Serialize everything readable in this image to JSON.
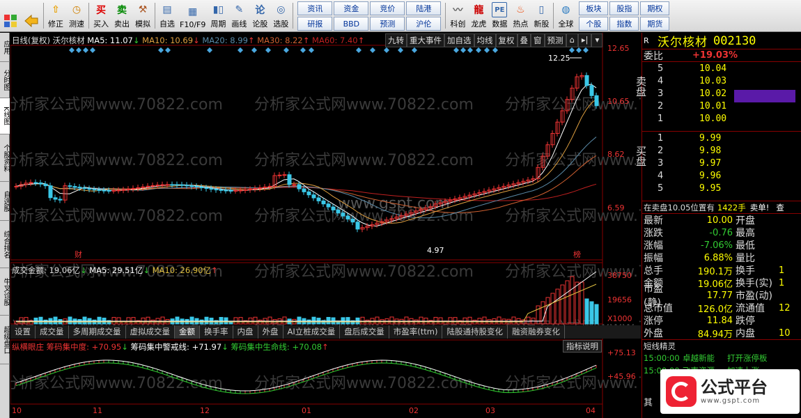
{
  "toolbar": {
    "buttons": [
      {
        "label": "修正",
        "icon": "up-arrow-icon"
      },
      {
        "label": "测速",
        "icon": "clock-icon"
      },
      {
        "label": "买入",
        "icon": "buy-icon"
      },
      {
        "label": "卖出",
        "icon": "sell-icon"
      },
      {
        "label": "模拟",
        "icon": "hammer-icon"
      },
      {
        "label": "自选",
        "icon": "folder-icon"
      },
      {
        "label": "F10/F9",
        "icon": "f10-icon"
      },
      {
        "label": "周期",
        "icon": "period-icon"
      },
      {
        "label": "画线",
        "icon": "pen-icon"
      },
      {
        "label": "论股",
        "icon": "discuss-icon"
      },
      {
        "label": "选股",
        "icon": "stock-pick-icon"
      }
    ],
    "grid": [
      "资讯",
      "资金",
      "竞价",
      "陆港",
      "研报",
      "BBD",
      "预测",
      "沪伦"
    ],
    "buttons2": [
      {
        "label": "科创",
        "icon": "sci-icon"
      },
      {
        "label": "龙虎",
        "icon": "dragon-icon"
      },
      {
        "label": "数据",
        "icon": "pe-icon"
      },
      {
        "label": "热点",
        "icon": "hot-icon"
      },
      {
        "label": "新股",
        "icon": "ipo-icon"
      },
      {
        "label": "全球",
        "icon": "globe-icon"
      }
    ],
    "grid2": [
      "板块",
      "股指",
      "期权",
      "个股",
      "指数",
      "期货"
    ]
  },
  "lefttabs": [
    "应用",
    "分时图",
    "K线图",
    "个股资料",
    "自选股",
    "综合排名",
    "牛叉诊股",
    "超级盘口"
  ],
  "chart_header": {
    "period": "日线(复权)",
    "name": "沃尔核材",
    "ma5": "MA5: 11.07",
    "ma10": "MA10: 10.69",
    "ma20": "MA20: 8.99",
    "ma30": "MA30: 8.22",
    "ma60": "MA60: 7.40"
  },
  "chart_tools": [
    "九转",
    "重大事件",
    "加自选",
    "均线",
    "复权",
    "叠",
    "窗",
    "预测"
  ],
  "price_axis": [
    "12.65",
    "10.65",
    "8.62",
    "6.59"
  ],
  "annotations": {
    "high": "12.25",
    "low": "4.97",
    "cai": "财",
    "bang": "榜"
  },
  "vol_header": {
    "label": "成交金额: 19.06亿",
    "ma5": "MA5: 29.51亿",
    "ma10": "MA10: 26.90亿"
  },
  "vol_axis": [
    "38750",
    "19656",
    "X1000"
  ],
  "tabs": [
    "设置",
    "成交量",
    "多周期成交量",
    "虚拟成交量",
    "金额",
    "换手率",
    "内盘",
    "外盘",
    "AI立桩成交量",
    "盘后成交量",
    "市盈率(ttm)",
    "陆股通持股变化",
    "融资融券变化"
  ],
  "ind_header": {
    "name": "纵横眼庄",
    "a": "筹码集中度: +70.95",
    "b": "筹码集中警戒线: +71.97",
    "c": "筹码集中生命线: +70.08",
    "btn": "指标说明"
  },
  "ind_axis": [
    "+75.13",
    "+45.96"
  ],
  "date_axis": [
    "10",
    "11",
    "12",
    "01",
    "02",
    "03",
    "04"
  ],
  "watermark": "分析家公式网www.70822.com",
  "watermark2": "www.gspt.com",
  "right": {
    "r": "R",
    "name": "沃尔核材",
    "code": "002130",
    "weibi_label": "委比",
    "weibi": "+19.03%",
    "sell_label": "卖盘",
    "buy_label": "买盘",
    "asks": [
      [
        "5",
        "10.04"
      ],
      [
        "4",
        "10.03"
      ],
      [
        "3",
        "10.02"
      ],
      [
        "2",
        "10.01"
      ],
      [
        "1",
        "10.00"
      ]
    ],
    "bids": [
      [
        "1",
        "9.99"
      ],
      [
        "2",
        "9.98"
      ],
      [
        "3",
        "9.97"
      ],
      [
        "4",
        "9.96"
      ],
      [
        "5",
        "9.95"
      ]
    ],
    "notice": "在卖盘10.05位置有",
    "notice_vol": "1422手",
    "notice_tail": "卖单!",
    "notice_tail2": "查",
    "quotes": [
      [
        "最新",
        "10.00",
        "开盘",
        ""
      ],
      [
        "涨跌",
        "-0.76",
        "最高",
        ""
      ],
      [
        "涨幅",
        "-7.06%",
        "最低",
        ""
      ],
      [
        "振幅",
        "6.88%",
        "量比",
        ""
      ],
      [
        "总手",
        "190.1万",
        "换手",
        "1"
      ],
      [
        "金额",
        "19.06亿",
        "换手(实)",
        "1"
      ],
      [
        "市盈(静)",
        "17.77",
        "市盈(动)",
        ""
      ],
      [
        "总市值",
        "126.0亿",
        "流通值",
        "12"
      ],
      [
        "涨停",
        "11.84",
        "跌停",
        ""
      ],
      [
        "外盘",
        "84.94万",
        "内盘",
        "10"
      ]
    ],
    "short_title": "短线精灵",
    "short": [
      [
        "15:00:00",
        "卓越新能",
        "打开涨停板"
      ],
      [
        "15:00:00",
        "飞南资源",
        "加速上涨"
      ]
    ],
    "logo_text": "公式平台",
    "logo_url": "www.gspt.com",
    "bottom_label": "其"
  }
}
